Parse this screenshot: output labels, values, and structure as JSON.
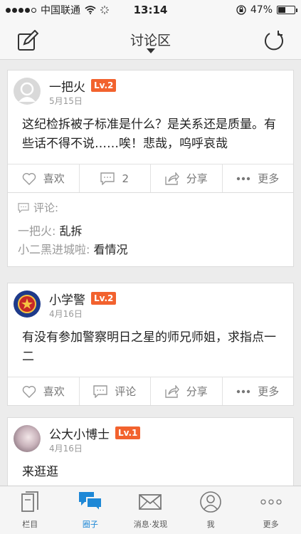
{
  "status": {
    "carrier": "中国联通",
    "time": "13:14",
    "battery_percent": "47%",
    "battery_level": 0.47
  },
  "nav": {
    "title": "讨论区",
    "left_icon": "compose-icon",
    "right_icon": "refresh-icon"
  },
  "posts": [
    {
      "user": "一把火",
      "level": "Lv.2",
      "date": "5月15日",
      "content": "这纪检拆被子标准是什么？是关系还是质量。有些话不得不说……唉！悲哉，呜呼哀哉",
      "actions": {
        "like": "喜欢",
        "comment": "2",
        "share": "分享",
        "more": "更多"
      },
      "comments_label": "评论:",
      "comments": [
        {
          "user": "一把火:",
          "text": "乱拆"
        },
        {
          "user": "小二黑进城啦:",
          "text": "看情况"
        }
      ]
    },
    {
      "user": "小学警",
      "level": "Lv.2",
      "date": "4月16日",
      "content": "有没有参加警察明日之星的师兄师姐，求指点一二",
      "actions": {
        "like": "喜欢",
        "comment": "评论",
        "share": "分享",
        "more": "更多"
      }
    },
    {
      "user": "公大小博士",
      "level": "Lv.1",
      "date": "4月16日",
      "content": "来逛逛"
    }
  ],
  "tabs": [
    {
      "label": "栏目",
      "icon": "columns-icon"
    },
    {
      "label": "圈子",
      "icon": "chat-bubbles-icon",
      "active": true
    },
    {
      "label": "消息·发现",
      "icon": "envelope-icon"
    },
    {
      "label": "我",
      "icon": "user-icon"
    },
    {
      "label": "更多",
      "icon": "more-dots-icon"
    }
  ],
  "colors": {
    "accent": "#1e88d6",
    "level_badge": "#f2622e"
  }
}
